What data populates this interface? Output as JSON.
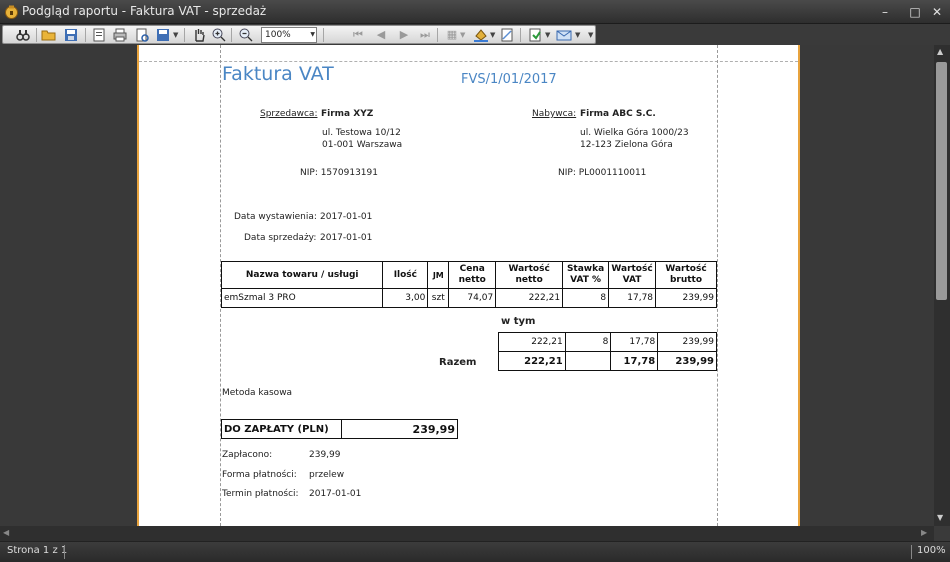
{
  "window": {
    "title": "Podgląd raportu - Faktura VAT - sprzedaż",
    "minimize": "–",
    "maximize": "□",
    "close": "✕"
  },
  "toolbar": {
    "zoom_value": "100%",
    "icons": [
      "binoculars-icon",
      "open-icon",
      "save-icon",
      "page-setup-icon",
      "print-icon",
      "print-preview-icon",
      "export-icon",
      "hand-tool-icon",
      "zoom-in-icon",
      "zoom-out-icon",
      "first-page-icon",
      "prev-page-icon",
      "next-page-icon",
      "last-page-icon",
      "multipage-icon",
      "background-color-icon",
      "watermark-icon",
      "export-document-icon",
      "send-email-icon"
    ]
  },
  "invoice": {
    "title": "Faktura VAT",
    "number": "FVS/1/01/2017",
    "seller_label": "Sprzedawca:",
    "seller_name": "Firma XYZ",
    "seller_street": "ul. Testowa 10/12",
    "seller_city": "01-001 Warszawa",
    "seller_nip": "NIP: 1570913191",
    "buyer_label": "Nabywca:",
    "buyer_name": "Firma ABC S.C.",
    "buyer_street": "ul. Wielka Góra 1000/23",
    "buyer_city": "12-123 Zielona Góra",
    "buyer_nip": "NIP: PL0001110011",
    "issue_label": "Data wystawienia:",
    "issue_date": "2017-01-01",
    "sale_label": "Data sprzedaży:",
    "sale_date": "2017-01-01",
    "headers": [
      "Nazwa towaru / usługi",
      "Ilość",
      "JM",
      "Cena netto",
      "Wartość netto",
      "Stawka VAT %",
      "Wartość VAT",
      "Wartość brutto"
    ],
    "row": [
      "emSzmal 3 PRO",
      "3,00",
      "szt",
      "74,07",
      "222,21",
      "8",
      "17,78",
      "239,99"
    ],
    "wtym_label": "w tym",
    "wtym_row": [
      "222,21",
      "8",
      "17,78",
      "239,99"
    ],
    "razem_label": "Razem",
    "razem_row": [
      "222,21",
      "",
      "17,78",
      "239,99"
    ],
    "method": "Metoda kasowa",
    "due_label": "DO ZAPŁATY (PLN)",
    "due_value": "239,99",
    "paid_label": "Zapłacono:",
    "paid_value": "239,99",
    "payment_form_label": "Forma płatności:",
    "payment_form_value": "przelew",
    "deadline_label": "Termin płatności:",
    "deadline_value": "2017-01-01"
  },
  "status": {
    "page": "Strona 1 z 1",
    "zoom": "100%"
  }
}
